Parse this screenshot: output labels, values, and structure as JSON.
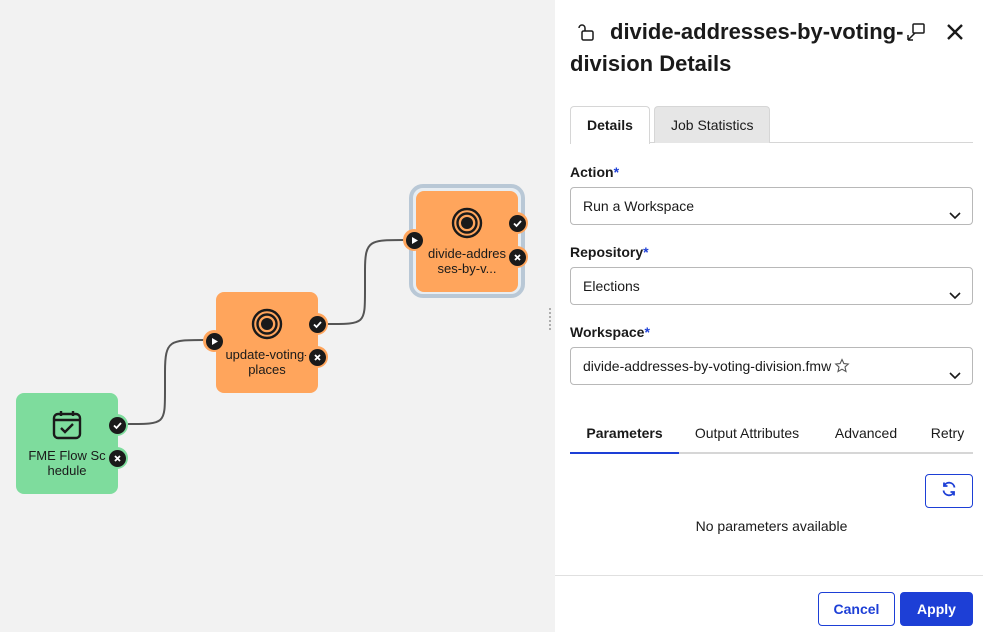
{
  "canvas": {
    "nodes": [
      {
        "id": "schedule",
        "label": "FME Flow Schedule",
        "icon": "calendar-check-icon",
        "color": "#7edc9d"
      },
      {
        "id": "update",
        "label": "update-voting-places",
        "icon": "target-icon",
        "color": "#ffa55c"
      },
      {
        "id": "divide",
        "label": "divide-addresses-by-v...",
        "icon": "target-icon",
        "color": "#ffa55c",
        "selected": true
      }
    ]
  },
  "panel": {
    "title": "divide-addresses-by-voting-division Details",
    "tabs": [
      {
        "label": "Details",
        "active": true
      },
      {
        "label": "Job Statistics",
        "active": false
      }
    ],
    "fields": {
      "action": {
        "label": "Action",
        "required_mark": "*",
        "value": "Run a Workspace"
      },
      "repository": {
        "label": "Repository",
        "required_mark": "*",
        "value": "Elections"
      },
      "workspace": {
        "label": "Workspace",
        "required_mark": "*",
        "value": "divide-addresses-by-voting-division.fmw"
      }
    },
    "subtabs": [
      {
        "label": "Parameters",
        "active": true
      },
      {
        "label": "Output Attributes",
        "active": false
      },
      {
        "label": "Advanced",
        "active": false
      },
      {
        "label": "Retry",
        "active": false
      }
    ],
    "empty_message": "No parameters available",
    "footer": {
      "cancel_label": "Cancel",
      "apply_label": "Apply"
    }
  },
  "colors": {
    "accent": "#1d3fd6",
    "node_green": "#7edc9d",
    "node_orange": "#ffa55c"
  }
}
